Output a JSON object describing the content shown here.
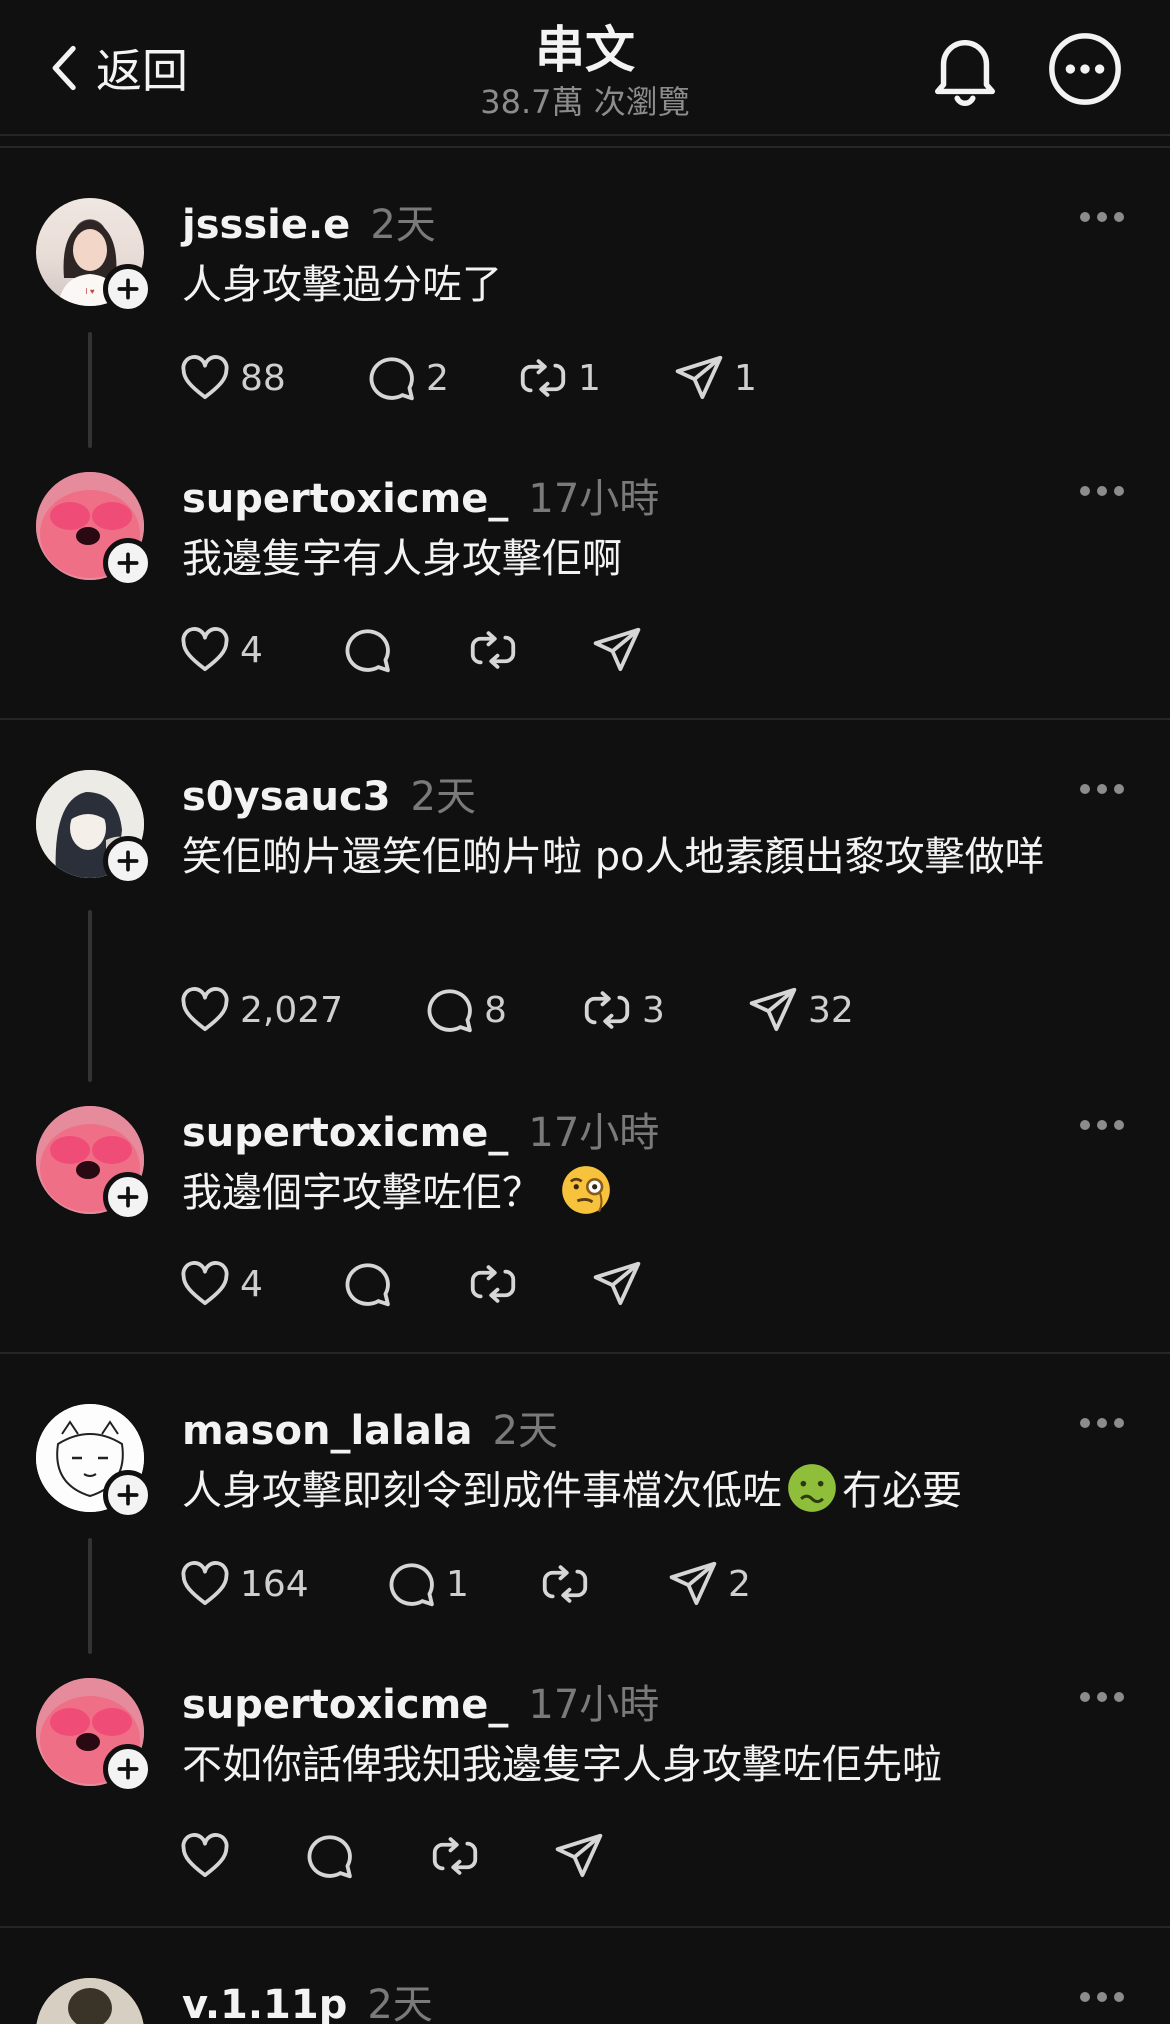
{
  "header": {
    "back_label": "返回",
    "title": "串文",
    "views": "38.7萬 次瀏覽"
  },
  "groups": [
    {
      "parent": {
        "username": "jsssie.e",
        "time": "2天",
        "text": "人身攻擊過分咗了",
        "likes": "88",
        "comments": "2",
        "reposts": "1",
        "shares": "1"
      },
      "reply": {
        "username": "supertoxicme_",
        "time": "17小時",
        "text": "我邊隻字有人身攻擊佢啊",
        "likes": "4",
        "comments": "",
        "reposts": "",
        "shares": ""
      }
    },
    {
      "parent": {
        "username": "s0ysauc3",
        "time": "2天",
        "text": "笑佢啲片還笑佢啲片啦 po人地素顏出黎攻擊做咩",
        "likes": "2,027",
        "comments": "8",
        "reposts": "3",
        "shares": "32"
      },
      "reply": {
        "username": "supertoxicme_",
        "time": "17小時",
        "text": "我邊個字攻擊咗佢？",
        "emoji": "face-with-monocle",
        "likes": "4",
        "comments": "",
        "reposts": "",
        "shares": ""
      }
    },
    {
      "parent": {
        "username": "mason_lalala",
        "time": "2天",
        "text_before": "人身攻擊即刻令到成件事檔次低咗",
        "emoji": "nauseated-face",
        "text_after": "冇必要",
        "likes": "164",
        "comments": "1",
        "reposts": "",
        "shares": "2"
      },
      "reply": {
        "username": "supertoxicme_",
        "time": "17小時",
        "text": "不如你話俾我知我邊隻字人身攻擊咗佢先啦",
        "likes": "",
        "comments": "",
        "reposts": "",
        "shares": ""
      }
    },
    {
      "parent": {
        "username": "v.1.11p",
        "time": "2天"
      }
    }
  ],
  "icons": {
    "like": "heart-icon",
    "comment": "comment-bubble-icon",
    "repost": "repost-icon",
    "share": "send-icon",
    "more": "more-dots-icon",
    "follow": "plus-icon"
  }
}
